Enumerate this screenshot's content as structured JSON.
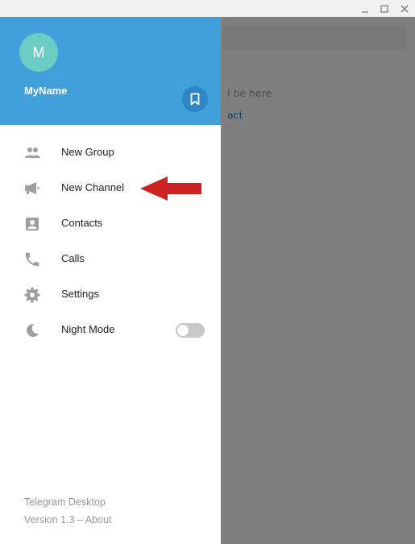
{
  "window": {
    "controls": [
      "minimize-icon",
      "maximize-icon",
      "close-icon"
    ]
  },
  "background": {
    "empty_text": "l be here",
    "link_text": "act"
  },
  "header": {
    "avatar_letter": "M",
    "username": "MyName",
    "saved_icon": "bookmark-icon",
    "colors": {
      "header_bg": "#419fd9",
      "avatar_bg": "#6ccdc5"
    }
  },
  "menu": {
    "items": [
      {
        "label": "New Group",
        "icon": "group-icon"
      },
      {
        "label": "New Channel",
        "icon": "megaphone-icon"
      },
      {
        "label": "Contacts",
        "icon": "contact-card-icon"
      },
      {
        "label": "Calls",
        "icon": "phone-icon"
      },
      {
        "label": "Settings",
        "icon": "gear-icon"
      },
      {
        "label": "Night Mode",
        "icon": "moon-icon",
        "toggle": false
      }
    ]
  },
  "footer": {
    "app_name": "Telegram Desktop",
    "version": "Version 1.3 – ",
    "about_link": "About"
  },
  "annotation": {
    "arrow_color": "#cc2222",
    "points_to": "New Channel"
  }
}
